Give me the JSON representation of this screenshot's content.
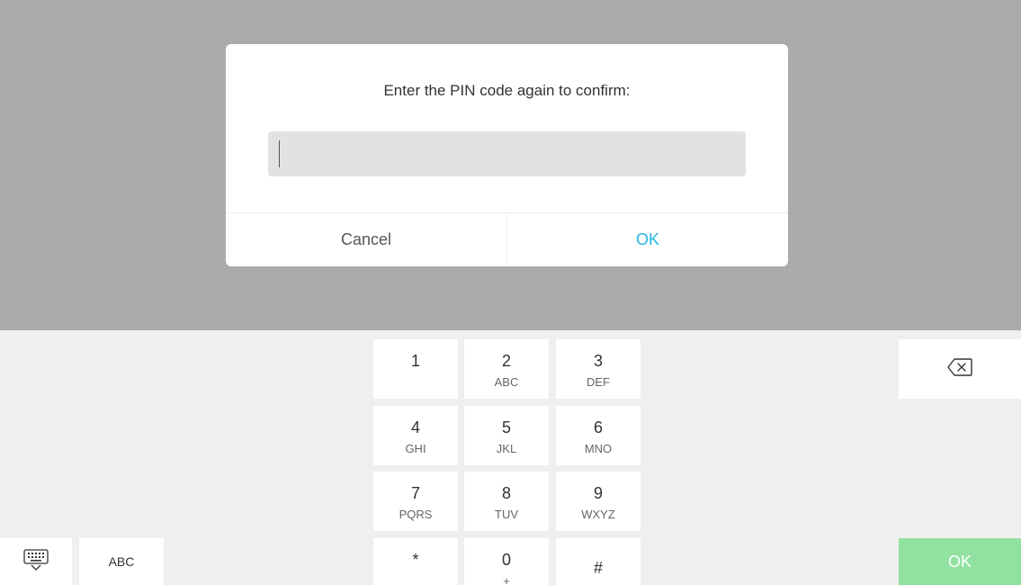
{
  "dialog": {
    "prompt": "Enter the PIN code again to confirm:",
    "pin_value": "",
    "cancel_label": "Cancel",
    "ok_label": "OK"
  },
  "keypad": {
    "keys": [
      {
        "digit": "1",
        "letters": ""
      },
      {
        "digit": "2",
        "letters": "ABC"
      },
      {
        "digit": "3",
        "letters": "DEF"
      },
      {
        "digit": "4",
        "letters": "GHI"
      },
      {
        "digit": "5",
        "letters": "JKL"
      },
      {
        "digit": "6",
        "letters": "MNO"
      },
      {
        "digit": "7",
        "letters": "PQRS"
      },
      {
        "digit": "8",
        "letters": "TUV"
      },
      {
        "digit": "9",
        "letters": "WXYZ"
      },
      {
        "digit": "*",
        "letters": ""
      },
      {
        "digit": "0",
        "letters": "+"
      },
      {
        "digit": "#",
        "letters": ""
      }
    ],
    "abc_label": "ABC",
    "ok_label": "OK",
    "backspace_icon": "backspace-icon",
    "keyboard_icon": "keyboard-icon"
  },
  "colors": {
    "accent": "#22b7e0",
    "ok_key": "#91e2a0",
    "backdrop": "#ababab",
    "keyboard_bg": "#efefef"
  }
}
